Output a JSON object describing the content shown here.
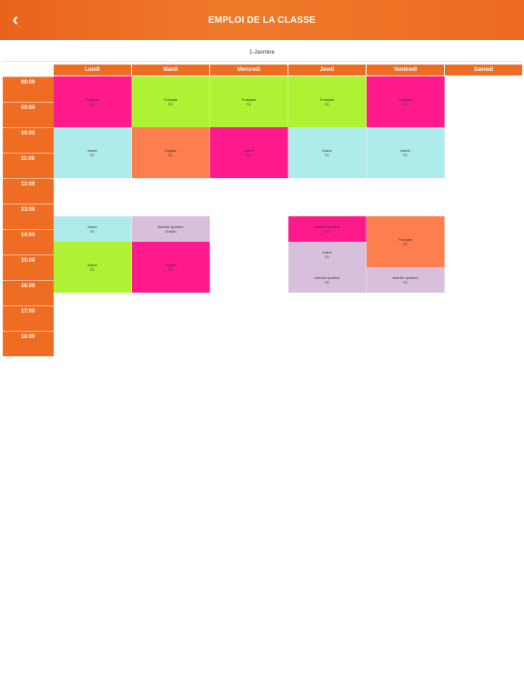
{
  "header": {
    "title": "EMPLOI DE LA CLASSE",
    "back_icon": "‹"
  },
  "class_name": "1-Jasmine",
  "days": [
    "Lundi",
    "Mardi",
    "Mercredi",
    "Jeudi",
    "Vendredi",
    "Samedi"
  ],
  "times": [
    "08:00",
    "09:00",
    "10:00",
    "11:00",
    "12:00",
    "13:00",
    "14:00",
    "15:00",
    "16:00",
    "17:00",
    "18:00"
  ],
  "colors": {
    "brand": "#ef6d23",
    "pink": "#ff1a8c",
    "lime": "#aef233",
    "cyan": "#aeeceb",
    "salmon": "#fd7f4f",
    "lavender": "#d8c0dc"
  },
  "sessions": [
    {
      "subject": "Français",
      "room": "S1"
    },
    {
      "subject": "Français",
      "room": "S1"
    },
    {
      "subject": "Français",
      "room": "S1"
    },
    {
      "subject": "Français",
      "room": "S1"
    },
    {
      "subject": "Français",
      "room": "S1"
    },
    {
      "subject": "Arabe",
      "room": "S1"
    },
    {
      "subject": "Anglais",
      "room": "S1"
    },
    {
      "subject": "Arabe",
      "room": "S1"
    },
    {
      "subject": "Arabe",
      "room": "S1"
    },
    {
      "subject": "Arabe",
      "room": "S1"
    },
    {
      "subject": "Arabe",
      "room": "S1"
    },
    {
      "subject": "Activité sportive",
      "room": "Terrain"
    },
    {
      "subject": "Arabe",
      "room": "S1"
    },
    {
      "subject": "Anglais",
      "room": "S1"
    },
    {
      "subject": "Activité sportive",
      "room": "S1"
    },
    {
      "subject": "Français",
      "room": "S1"
    },
    {
      "subject": "Arabe",
      "room": "S1"
    },
    {
      "subject": "Activité sportive",
      "room": "S1"
    },
    {
      "subject": "Activité sportive",
      "room": "S1"
    }
  ]
}
